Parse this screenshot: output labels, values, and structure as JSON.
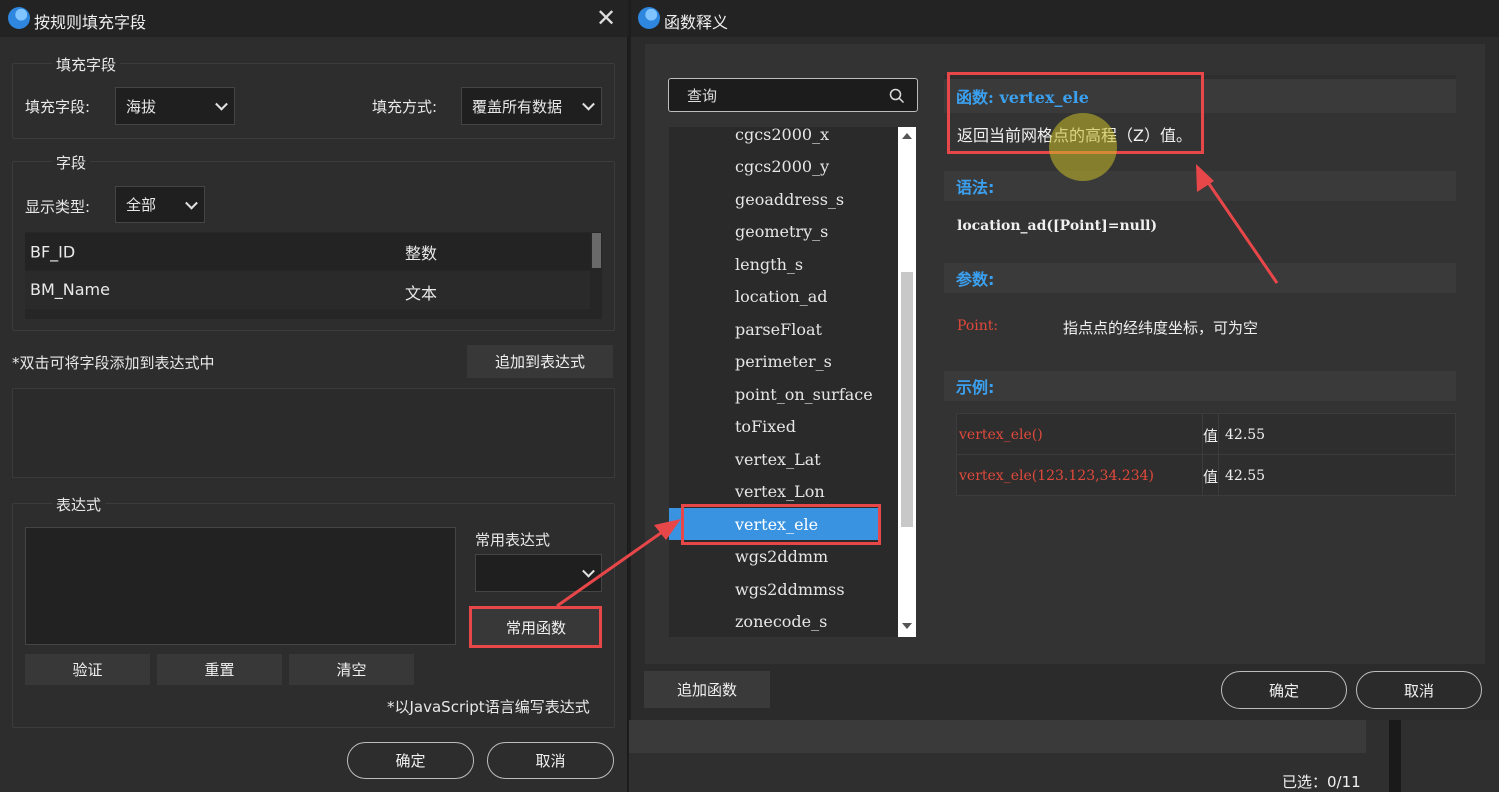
{
  "left_dialog": {
    "title": "按规则填充字段",
    "fill_group": {
      "title": "填充字段",
      "field_label": "填充字段:",
      "field_value": "海拔",
      "mode_label": "填充方式:",
      "mode_value": "覆盖所有数据"
    },
    "fields_group": {
      "title": "字段",
      "display_type_label": "显示类型:",
      "display_type_value": "全部",
      "rows": [
        {
          "name": "BF_ID",
          "type": "整数"
        },
        {
          "name": "BM_Name",
          "type": "文本"
        }
      ]
    },
    "hint": "*双击可将字段添加到表达式中",
    "add_to_expression": "追加到表达式",
    "expr_group": {
      "title": "表达式",
      "common_expr_label": "常用表达式",
      "common_func_button": "常用函数",
      "validate": "验证",
      "reset": "重置",
      "clear": "清空",
      "js_note": "*以JavaScript语言编写表达式"
    },
    "ok": "确定",
    "cancel": "取消"
  },
  "right_dialog": {
    "title": "函数释义",
    "search_placeholder": "查询",
    "functions": [
      "cgcs2000_x",
      "cgcs2000_y",
      "geoaddress_s",
      "geometry_s",
      "length_s",
      "location_ad",
      "parseFloat",
      "perimeter_s",
      "point_on_surface",
      "toFixed",
      "vertex_Lat",
      "vertex_Lon",
      "vertex_ele",
      "wgs2ddmm",
      "wgs2ddmmss",
      "zonecode_s"
    ],
    "selected_function": "vertex_ele",
    "detail": {
      "func_heading": "函数: vertex_ele",
      "description": "返回当前网格点的高程（Z）值。",
      "syntax_heading": "语法:",
      "syntax": "location_ad([Point]=null)",
      "params_heading": "参数:",
      "param_name": "Point:",
      "param_desc": "指点点的经纬度坐标，可为空",
      "examples_heading": "示例:",
      "examples": [
        {
          "expr": "vertex_ele()",
          "label": "值",
          "value": "42.55"
        },
        {
          "expr": "vertex_ele(123.123,34.234)",
          "label": "值",
          "value": "42.55"
        }
      ]
    },
    "add_function": "追加函数",
    "ok": "确定",
    "cancel": "取消"
  },
  "background": {
    "selected_count": "已选：0/11"
  },
  "colors": {
    "accent_blue": "#3a93e0",
    "heading_blue": "#3aa0ef",
    "highlight_red": "#e8474a"
  }
}
